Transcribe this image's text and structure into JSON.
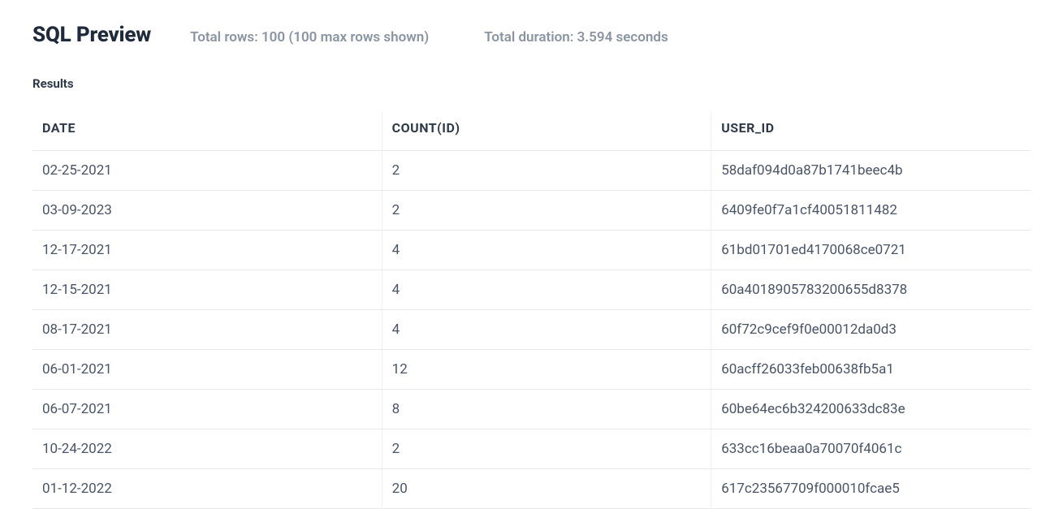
{
  "header": {
    "title": "SQL Preview",
    "rows_info": "Total rows: 100 (100 max rows shown)",
    "duration_info": "Total duration: 3.594 seconds"
  },
  "results_label": "Results",
  "table": {
    "columns": [
      "DATE",
      "COUNT(ID)",
      "USER_ID"
    ],
    "rows": [
      {
        "date": "02-25-2021",
        "count": "2",
        "user_id": "58daf094d0a87b1741beec4b"
      },
      {
        "date": "03-09-2023",
        "count": "2",
        "user_id": "6409fe0f7a1cf40051811482"
      },
      {
        "date": "12-17-2021",
        "count": "4",
        "user_id": "61bd01701ed4170068ce0721"
      },
      {
        "date": "12-15-2021",
        "count": "4",
        "user_id": "60a4018905783200655d8378"
      },
      {
        "date": "08-17-2021",
        "count": "4",
        "user_id": "60f72c9cef9f0e00012da0d3"
      },
      {
        "date": "06-01-2021",
        "count": "12",
        "user_id": "60acff26033feb00638fb5a1"
      },
      {
        "date": "06-07-2021",
        "count": "8",
        "user_id": "60be64ec6b324200633dc83e"
      },
      {
        "date": "10-24-2022",
        "count": "2",
        "user_id": "633cc16beaa0a70070f4061c"
      },
      {
        "date": "01-12-2022",
        "count": "20",
        "user_id": "617c23567709f000010fcae5"
      }
    ]
  }
}
